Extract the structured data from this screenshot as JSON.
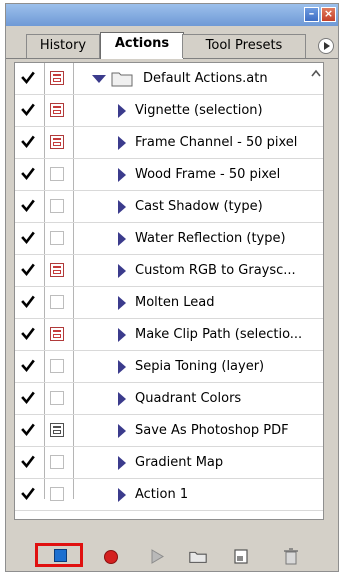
{
  "panel": {
    "tabs": [
      {
        "label": "History"
      },
      {
        "label": "Actions"
      },
      {
        "label": "Tool Presets"
      }
    ]
  },
  "actions": {
    "set": {
      "label": "Default Actions.atn",
      "checked": true,
      "dialog": "on",
      "expanded": true
    },
    "items": [
      {
        "label": "Vignette (selection)",
        "checked": true,
        "dialog": "on"
      },
      {
        "label": "Frame Channel - 50 pixel",
        "checked": true,
        "dialog": "on"
      },
      {
        "label": "Wood Frame - 50 pixel",
        "checked": true,
        "dialog": "off"
      },
      {
        "label": "Cast Shadow (type)",
        "checked": true,
        "dialog": "off"
      },
      {
        "label": "Water Reflection (type)",
        "checked": true,
        "dialog": "off"
      },
      {
        "label": "Custom RGB to Graysc...",
        "checked": true,
        "dialog": "on"
      },
      {
        "label": "Molten Lead",
        "checked": true,
        "dialog": "off"
      },
      {
        "label": "Make Clip Path (selectio...",
        "checked": true,
        "dialog": "on"
      },
      {
        "label": "Sepia Toning (layer)",
        "checked": true,
        "dialog": "off"
      },
      {
        "label": "Quadrant Colors",
        "checked": true,
        "dialog": "off"
      },
      {
        "label": "Save As Photoshop PDF",
        "checked": true,
        "dialog": "mixed"
      },
      {
        "label": "Gradient Map",
        "checked": true,
        "dialog": "off"
      },
      {
        "label": "Action 1",
        "checked": true,
        "dialog": "off"
      }
    ]
  },
  "footer": {
    "buttons": [
      {
        "icon": "stop-icon"
      },
      {
        "icon": "record-icon"
      },
      {
        "icon": "play-icon"
      },
      {
        "icon": "new-set-icon"
      },
      {
        "icon": "new-action-icon"
      },
      {
        "icon": "trash-icon"
      }
    ]
  },
  "colors": {
    "accent_red": "#e01010",
    "stop_blue": "#1c6fd0",
    "record_red": "#d42020"
  }
}
